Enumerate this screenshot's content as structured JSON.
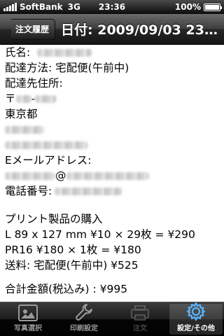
{
  "status_bar": {
    "carrier": "SoftBank",
    "network": "3G",
    "time": "23:36",
    "battery_label": "100%",
    "battery_level": 1.0
  },
  "nav": {
    "back_label": "注文履歴",
    "title": "日付: 2009/09/03 23:32..."
  },
  "order": {
    "name_label": "氏名:",
    "delivery_method_label": "配達方法: 宅配便(午前中)",
    "address_label": "配達先住所:",
    "postal_prefix": "〒",
    "postal_separator": "-",
    "prefecture": "東京都",
    "email_label": "Eメールアドレス:",
    "email_at": "@",
    "phone_label": "電話番号:",
    "purchase_heading": "プリント製品の購入",
    "items": [
      "L 89 x 127 mm ¥10 × 29枚 = ¥290",
      "PR16 ¥180 × 1枚 = ¥180",
      "送料: 宅配便(午前中) ¥525"
    ],
    "total": "合計金額(税込み) : ¥995"
  },
  "tabs": [
    {
      "label": "写真選択",
      "icon": "photo-icon",
      "state": "normal"
    },
    {
      "label": "印刷設定",
      "icon": "wrench-icon",
      "state": "normal"
    },
    {
      "label": "注文",
      "icon": "printer-icon",
      "state": "disabled"
    },
    {
      "label": "設定/その他",
      "icon": "gear-icon",
      "state": "selected"
    }
  ],
  "colors": {
    "tab_selected": "#ffffff",
    "tab_normal": "#9a9a9a",
    "gear_icon": "#5ab4ff"
  }
}
